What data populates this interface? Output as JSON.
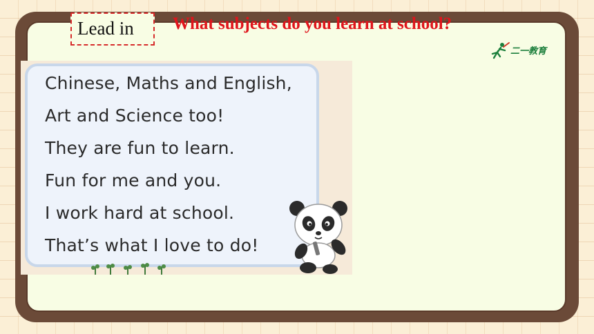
{
  "lead_in_label": "Lead in",
  "question": "What  subjects do you learn at school?",
  "logo_text": "二一教育",
  "poem_lines": [
    "Chinese, Maths and English,",
    "Art and Science too!",
    "They are fun to learn.",
    "Fun for me and you.",
    "I work hard at school.",
    "That’s what I love to do!"
  ],
  "colors": {
    "frame": "#6b4a38",
    "board": "#f8fde4",
    "question_red": "#e0151c",
    "card_bg": "#eef3fb",
    "logo_green": "#1c7f3c"
  }
}
